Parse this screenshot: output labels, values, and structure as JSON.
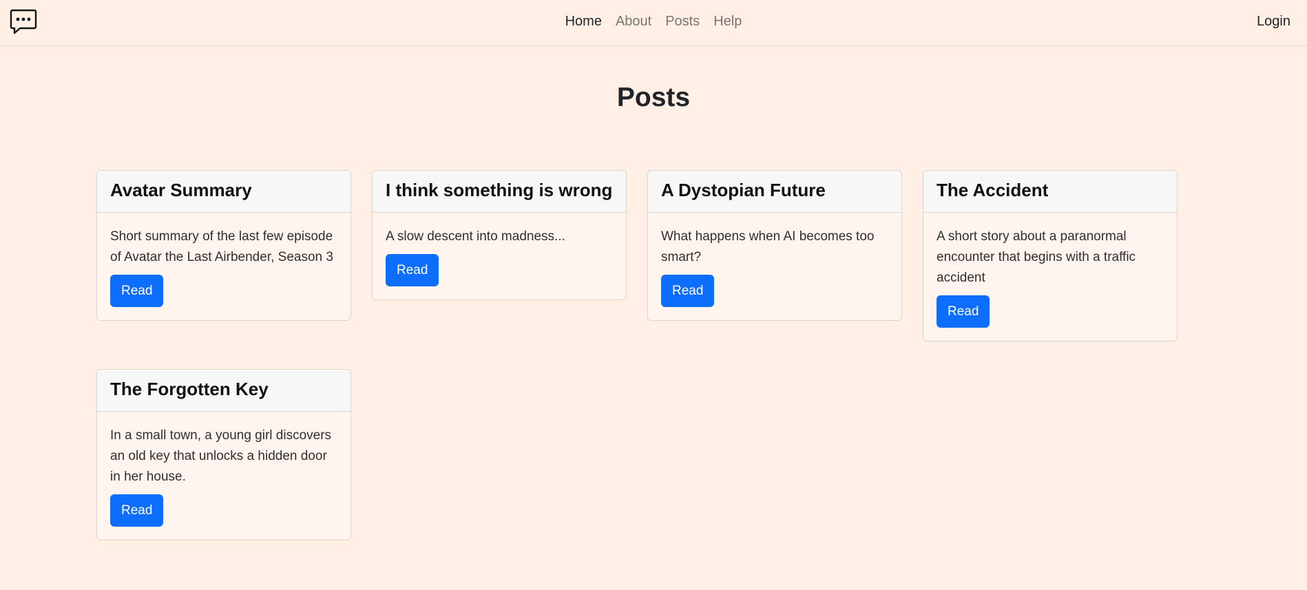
{
  "nav": {
    "logo_icon": "chat-dots-icon",
    "links": [
      {
        "label": "Home",
        "active": true
      },
      {
        "label": "About",
        "active": false
      },
      {
        "label": "Posts",
        "active": false
      },
      {
        "label": "Help",
        "active": false
      }
    ],
    "login_label": "Login"
  },
  "page": {
    "title": "Posts"
  },
  "posts": [
    {
      "title": "Avatar Summary",
      "summary": "Short summary of the last few episode of Avatar the Last Airbender, Season 3",
      "button_label": "Read"
    },
    {
      "title": "I think something is wrong",
      "summary": "A slow descent into madness...",
      "button_label": "Read"
    },
    {
      "title": "A Dystopian Future",
      "summary": "What happens when AI becomes too smart?",
      "button_label": "Read"
    },
    {
      "title": "The Accident",
      "summary": "A short story about a paranormal encounter that begins with a traffic accident",
      "button_label": "Read"
    },
    {
      "title": "The Forgotten Key",
      "summary": "In a small town, a young girl discovers an old key that unlocks a hidden door in her house.",
      "button_label": "Read"
    }
  ],
  "colors": {
    "background": "#ffefe4",
    "button": "#0d6efd",
    "card_header": "#f7f7f7"
  }
}
